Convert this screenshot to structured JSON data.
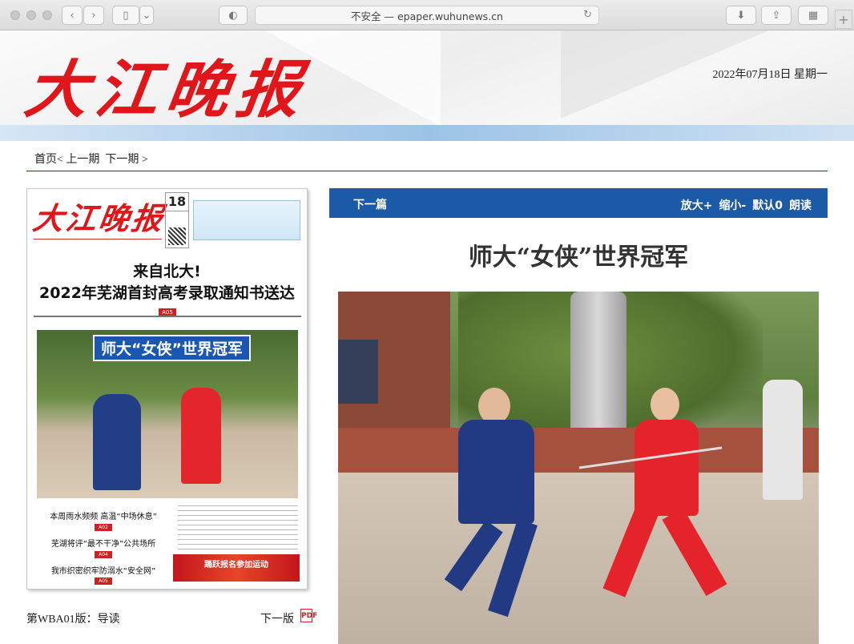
{
  "browser": {
    "url_text": "不安全 — epaper.wuhunews.cn"
  },
  "banner": {
    "logo_text": "大江晚报",
    "date": "2022年07月18日  星期一"
  },
  "nav": {
    "home": "首页",
    "prev": "< 上一期",
    "next": "下一期 >"
  },
  "thumbnail": {
    "logo_text": "大江晚报",
    "day": "18",
    "headline_1": "来自北大!",
    "headline_2": "2022年芜湖首封高考录取通知书送达",
    "photo_caption": "师大“女侠”世界冠军",
    "items": [
      {
        "text": "本周雨水频频  高温“中场休息”",
        "tag": "A02"
      },
      {
        "text": "芜湖将评“最不干净”公共场所",
        "tag": "A04"
      },
      {
        "text": "我市织密织牢防溺水“安全网”",
        "tag": "A05"
      }
    ],
    "page_tag": "A05",
    "ad_text": "踊跃报名参加运动"
  },
  "page_info": {
    "edition": "第WBA01版：导读",
    "next_edition": "下一版",
    "pdf_icon": "pdf-icon"
  },
  "article": {
    "next_label": "下一篇",
    "tools": {
      "zoom_in": "放大+",
      "zoom_out": "缩小-",
      "default": "默认0",
      "read": "朗读"
    },
    "title": "师大“女侠”世界冠军"
  },
  "colors": {
    "brand_red": "#e0161b",
    "bar_blue": "#1a5aa6",
    "nav_rule": "#1e3f62"
  }
}
